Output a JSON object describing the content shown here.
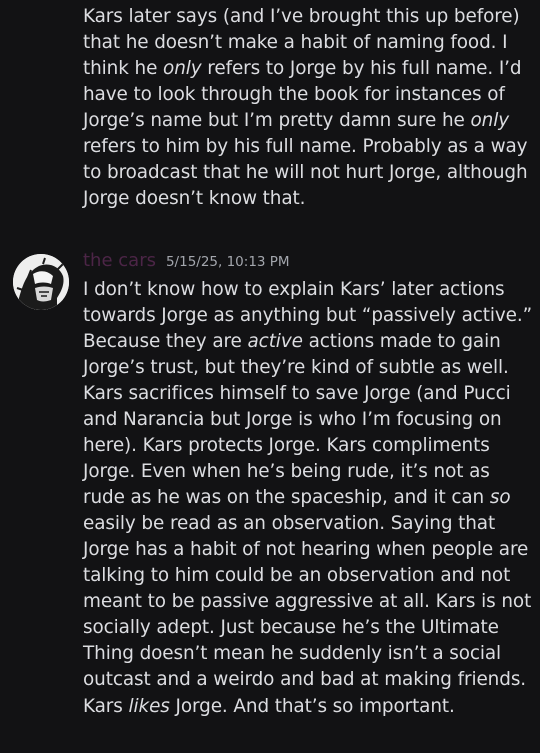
{
  "messages": [
    {
      "continuation": true,
      "paragraphs": [
        [
          {
            "t": "Kars later says (and I’ve brought this up before) that he doesn’t make a habit of naming food. I think he "
          },
          {
            "t": "only",
            "i": true
          },
          {
            "t": " refers to Jorge by his full name. I’d have to look through the book for instances of Jorge’s name but I’m pretty damn sure he "
          },
          {
            "t": "only",
            "i": true
          },
          {
            "t": " refers to him by his full name. Probably as a way to broadcast that he will not hurt Jorge, although Jorge doesn’t know that."
          }
        ]
      ]
    },
    {
      "username": "the cars",
      "timestamp": "5/15/25, 10:13 PM",
      "avatar_icon": "user-avatar-icon",
      "username_color": "#4c2547",
      "paragraphs": [
        [
          {
            "t": "I don’t know how to explain Kars’ later actions towards Jorge as anything but “passively active.” Because they are "
          },
          {
            "t": "active",
            "i": true
          },
          {
            "t": " actions made to gain Jorge’s trust, but they’re kind of subtle as well. Kars sacrifices himself to save Jorge (and Pucci and Narancia but Jorge is who I’m focusing on here). Kars protects Jorge. Kars compliments Jorge. Even when he’s being rude, it’s not as rude as he was on the spaceship, and it can "
          },
          {
            "t": "so",
            "i": true
          },
          {
            "t": " easily be read as an observation. Saying that Jorge has a habit of not hearing when people are talking to him could be an observation and not meant to be passive aggressive at all. Kars is not socially adept. Just because he’s the Ultimate Thing doesn’t mean he suddenly isn’t a social outcast and a weirdo and bad at making friends."
          }
        ],
        [
          {
            "t": "Kars "
          },
          {
            "t": "likes",
            "i": true
          },
          {
            "t": " Jorge. And that’s so important."
          }
        ]
      ]
    }
  ]
}
